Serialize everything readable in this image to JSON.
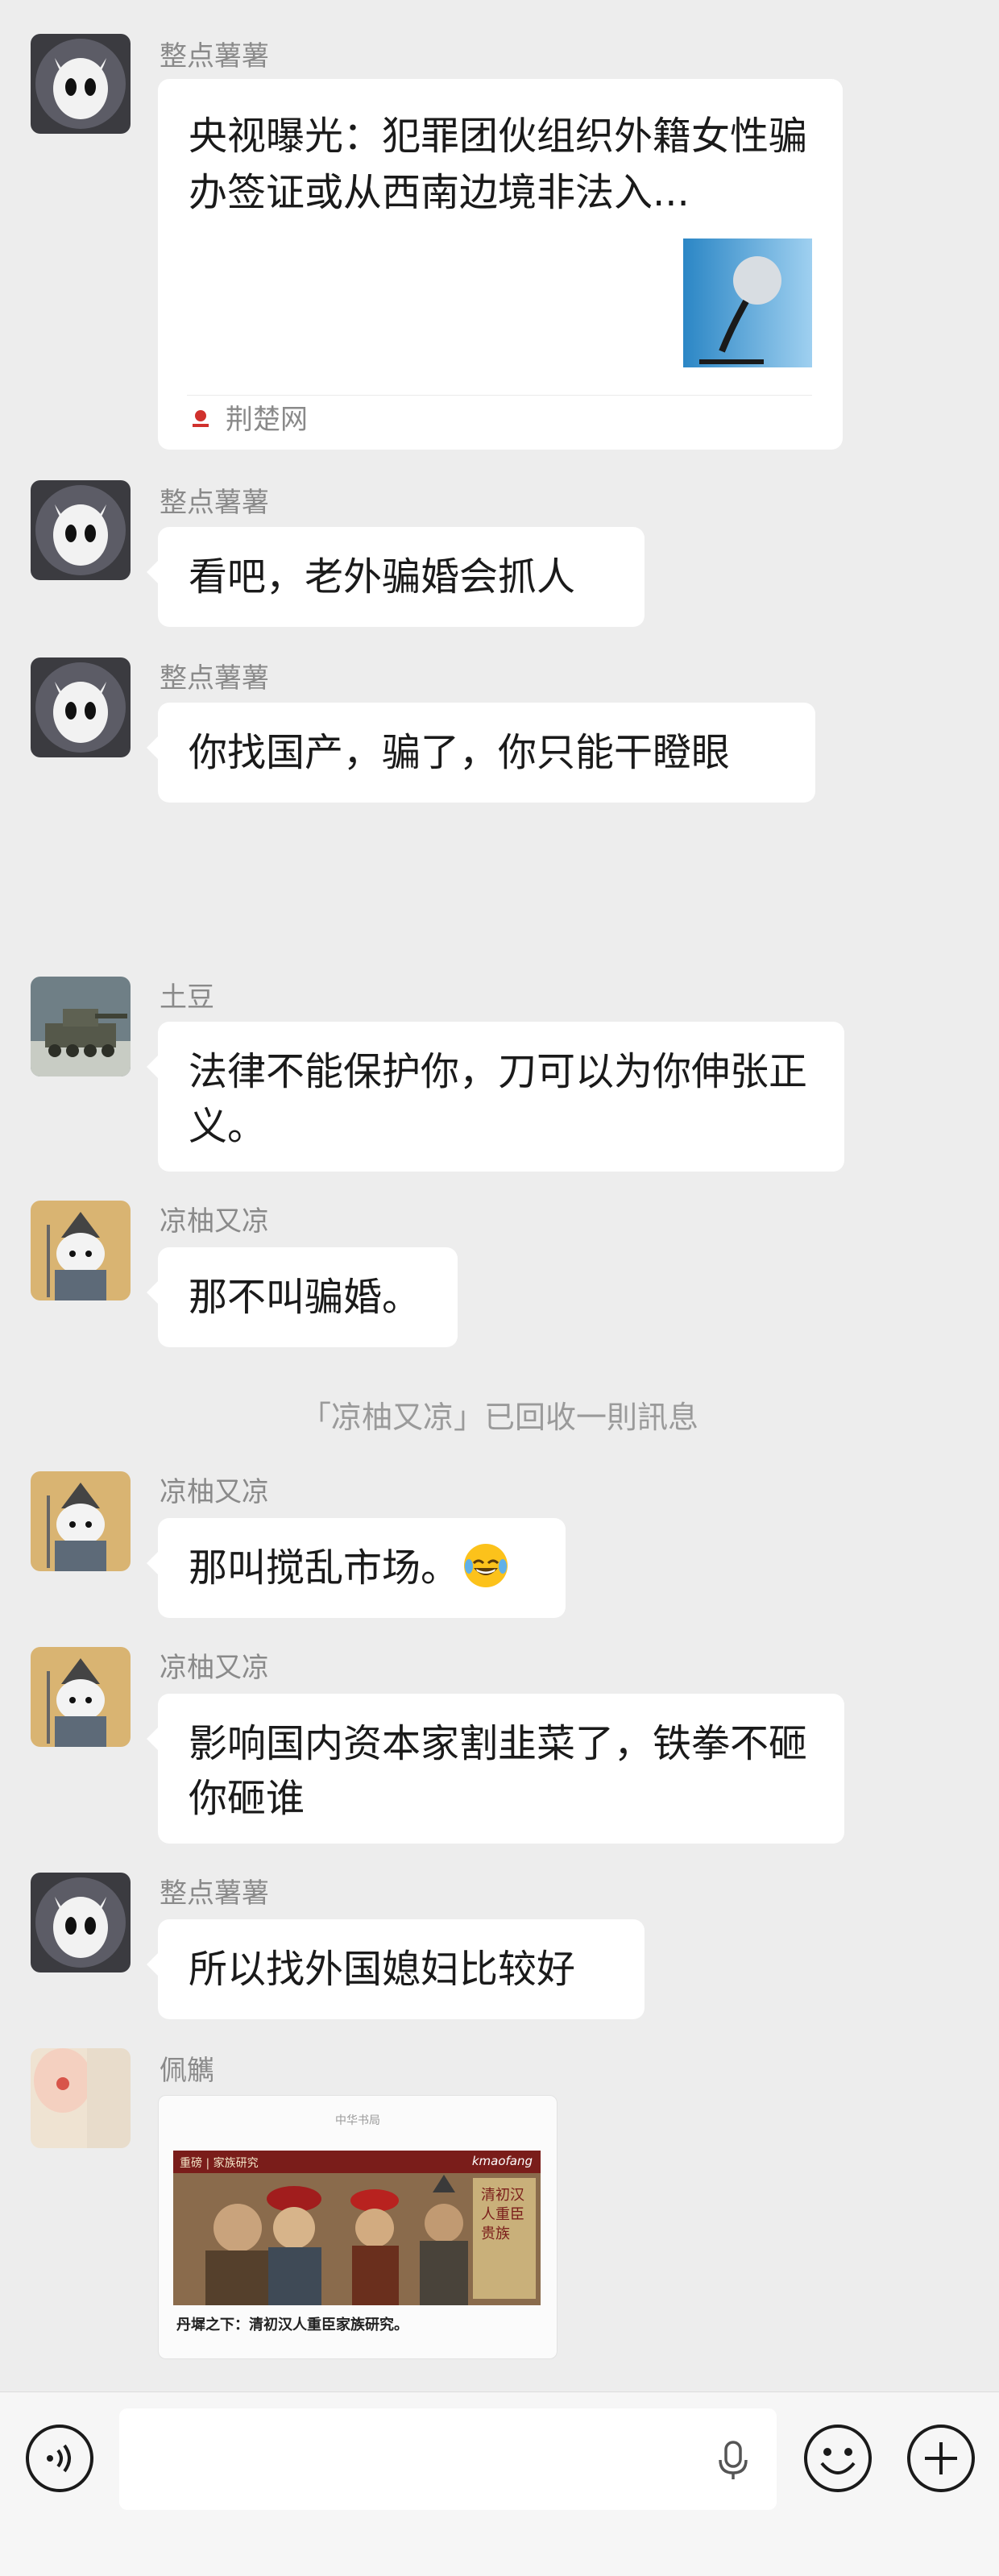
{
  "messages": [
    {
      "sender": "整点薯薯",
      "type": "link_card",
      "card": {
        "title": "央视曝光：犯罪团伙组织外籍女性骗办签证或从西南边境非法入...",
        "source": "荆楚网",
        "thumb_icon": "microphone-thumbnail"
      }
    },
    {
      "sender": "整点薯薯",
      "text": "看吧，老外骗婚会抓人"
    },
    {
      "sender": "整点薯薯",
      "text": "你找国产，骗了，你只能干瞪眼"
    },
    {
      "sender": "土豆",
      "text": "法律不能保护你，刀可以为你伸张正义。"
    },
    {
      "sender": "凉柚又凉",
      "text": "那不叫骗婚。"
    },
    {
      "sender": "凉柚又凉",
      "text": "那叫搅乱市场。",
      "emoji": "grin-sweat-emoji"
    },
    {
      "sender": "凉柚又凉",
      "text": "影响国内资本家割韭菜了，铁拳不砸你砸谁"
    },
    {
      "sender": "整点薯薯",
      "text": "所以找外国媳妇比较好"
    },
    {
      "sender": "佩觽",
      "type": "article_card",
      "card": {
        "header": "中华书局",
        "brand": "kmaofang",
        "tag": "重磅 | 家族研究",
        "side_text": "清初汉人重臣贵族",
        "caption": "丹墀之下：清初汉人重臣家族研究。"
      }
    }
  ],
  "system_notice": "「凉柚又凉」已回收一則訊息",
  "input_bar": {
    "placeholder": "",
    "voice_icon": "voice-icon",
    "mic_icon": "mic-icon",
    "emoji_icon": "emoji-icon",
    "plus_icon": "plus-icon"
  },
  "colors": {
    "background": "#ededed",
    "bubble": "#ffffff",
    "name": "#8a8a8a",
    "system": "#9a9a9a"
  }
}
